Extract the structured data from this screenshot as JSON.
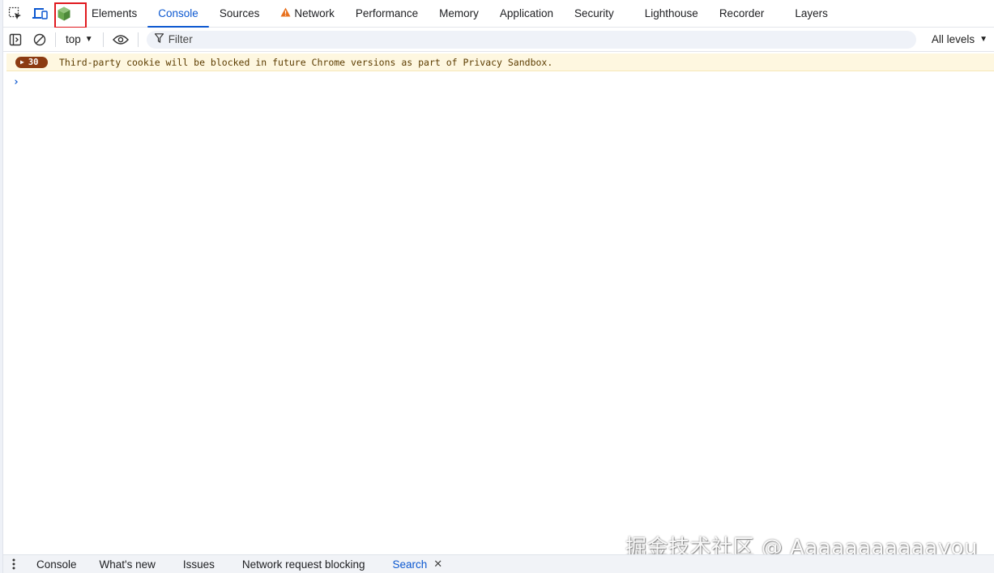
{
  "top_tabs": [
    {
      "label": "Elements"
    },
    {
      "label": "Console"
    },
    {
      "label": "Sources"
    },
    {
      "label": "Network"
    },
    {
      "label": "Performance"
    },
    {
      "label": "Memory"
    },
    {
      "label": "Application"
    },
    {
      "label": "Security"
    },
    {
      "label": "Lighthouse"
    },
    {
      "label": "Recorder"
    },
    {
      "label": "Layers"
    }
  ],
  "active_tab": "Console",
  "toolbar": {
    "context": "top",
    "filter_placeholder": "Filter",
    "levels": "All levels"
  },
  "messages": [
    {
      "count": "30",
      "level": "warning",
      "text": "Third-party cookie will be blocked in future Chrome versions as part of Privacy Sandbox."
    }
  ],
  "prompt": "›",
  "drawer_tabs": [
    {
      "label": "Console"
    },
    {
      "label": "What's new"
    },
    {
      "label": "Issues"
    },
    {
      "label": "Network request blocking"
    },
    {
      "label": "Search"
    }
  ],
  "watermark": "掘金技术社区 @ Aaaaaaaaaaayou",
  "colors": {
    "accent": "#0b57d0",
    "warning_bg": "#fef7e0",
    "badge_bg": "#8c3b12",
    "warning_icon": "#e8711e",
    "extension_icon": "#6aa84f",
    "highlight_box": "#e0191e"
  },
  "icons": [
    "inspect-element-icon",
    "device-toolbar-icon",
    "extension-icon",
    "warning-icon",
    "sidebar-toggle-icon",
    "clear-console-icon",
    "eye-icon",
    "filter-icon",
    "kebab-menu-icon",
    "close-icon"
  ]
}
